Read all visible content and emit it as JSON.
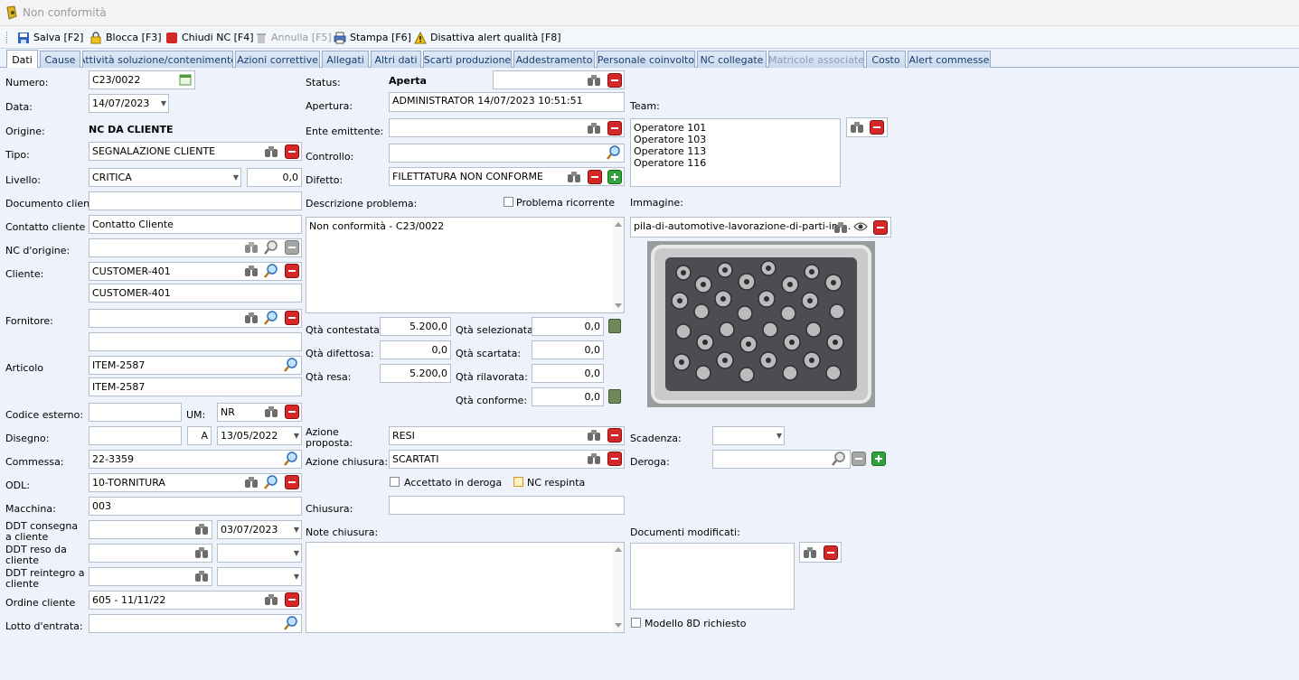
{
  "window": {
    "title": "Non conformità"
  },
  "toolbar": {
    "save": "Salva [F2]",
    "lock": "Blocca [F3]",
    "close_nc": "Chiudi NC [F4]",
    "cancel": "Annulla [F5]",
    "print": "Stampa [F6]",
    "disable_alert": "Disattiva alert qualità [F8]"
  },
  "tabs": [
    "Dati",
    "Cause",
    "Attività soluzione/contenimento",
    "Azioni correttive",
    "Allegati",
    "Altri dati",
    "Scarti produzione",
    "Addestramento",
    "Personale coinvolto",
    "NC collegate",
    "Matricole associate",
    "Costo",
    "Alert commesse"
  ],
  "left": {
    "numero_label": "Numero:",
    "numero": "C23/0022",
    "data_label": "Data:",
    "data": "14/07/2023",
    "origine_label": "Origine:",
    "origine": "NC DA CLIENTE",
    "tipo_label": "Tipo:",
    "tipo": "SEGNALAZIONE CLIENTE",
    "livello_label": "Livello:",
    "livello": "CRITICA",
    "livello_val": "0,0",
    "doc_cliente_label": "Documento cliente",
    "doc_cliente": "",
    "contatto_label": "Contatto cliente",
    "contatto": "Contatto Cliente",
    "nc_origine_label": "NC d'origine:",
    "nc_origine": "",
    "cliente_label": "Cliente:",
    "cliente_code": "CUSTOMER-401",
    "cliente_name": "CUSTOMER-401",
    "fornitore_label": "Fornitore:",
    "fornitore": "",
    "fornitore_name": "",
    "articolo_label": "Articolo",
    "articolo_code": "ITEM-2587",
    "articolo_name": "ITEM-2587",
    "codice_esterno_label": "Codice esterno:",
    "codice_esterno": "",
    "um_label": "UM:",
    "um": "NR",
    "disegno_label": "Disegno:",
    "disegno": "",
    "disegno_rev": "A",
    "disegno_date": "13/05/2022",
    "commessa_label": "Commessa:",
    "commessa": "22-3359",
    "odl_label": "ODL:",
    "odl": "10-TORNITURA",
    "macchina_label": "Macchina:",
    "macchina": "003",
    "ddt_consegna_label": "DDT consegna a cliente",
    "ddt_consegna_date": "03/07/2023",
    "ddt_reso_label": "DDT reso da cliente",
    "ddt_reintegro_label": "DDT reintegro a cliente",
    "ordine_label": "Ordine cliente",
    "ordine": "605 - 11/11/22",
    "lotto_label": "Lotto d'entrata:",
    "lotto": ""
  },
  "middle": {
    "status_label": "Status:",
    "status": "Aperta",
    "apertura_label": "Apertura:",
    "apertura": "ADMINISTRATOR 14/07/2023 10:51:51",
    "ente_label": "Ente emittente:",
    "controllo_label": "Controllo:",
    "difetto_label": "Difetto:",
    "difetto": "FILETTATURA NON CONFORME",
    "descr_label": "Descrizione problema:",
    "ricorrente_label": "Problema ricorrente",
    "descr": "Non conformità - C23/0022",
    "qta_contestata_label": "Qtà contestata:",
    "qta_contestata": "5.200,0",
    "qta_difettosa_label": "Qtà difettosa:",
    "qta_difettosa": "0,0",
    "qta_resa_label": "Qtà resa:",
    "qta_resa": "5.200,0",
    "qta_selezionata_label": "Qtà selezionata:",
    "qta_selezionata": "0,0",
    "qta_scartata_label": "Qtà scartata:",
    "qta_scartata": "0,0",
    "qta_rilavorata_label": "Qtà rilavorata:",
    "qta_rilavorata": "0,0",
    "qta_conforme_label": "Qtà conforme:",
    "qta_conforme": "0,0",
    "azione_proposta_label": "Azione proposta:",
    "azione_proposta": "RESI",
    "azione_chiusura_label": "Azione chiusura:",
    "azione_chiusura": "SCARTATI",
    "deroga_check_label": "Accettato in deroga",
    "respinta_label": "NC respinta",
    "chiusura_label": "Chiusura:",
    "note_label": "Note chiusura:"
  },
  "right": {
    "team_label": "Team:",
    "team": [
      "Operatore 101",
      "Operatore 103",
      "Operatore 113",
      "Operatore 116"
    ],
    "immagine_label": "Immagine:",
    "immagine": "pila-di-automotive-lavorazione-di-parti-in-...",
    "scadenza_label": "Scadenza:",
    "deroga_label": "Deroga:",
    "doc_mod_label": "Documenti modificati:",
    "modello_label": "Modello 8D richiesto"
  },
  "colors": {
    "accent": "#1a3e6e",
    "red": "#d42828",
    "green": "#32a33a"
  }
}
